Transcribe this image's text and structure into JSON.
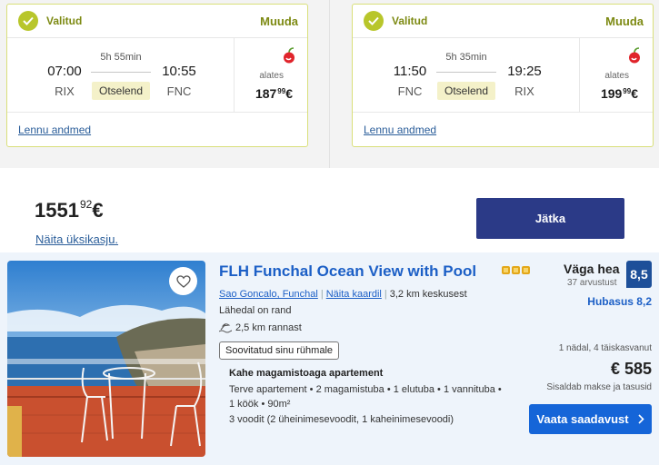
{
  "outbound": {
    "selected_label": "Valitud",
    "change_label": "Muuda",
    "dep_time": "07:00",
    "dep_code": "RIX",
    "duration": "5h 55min",
    "stops": "Otselend",
    "arr_time": "10:55",
    "arr_code": "FNC",
    "from_label": "alates",
    "price_main": "187",
    "price_cents": "99",
    "currency": "€",
    "details_label": "Lennu andmed",
    "airline_icon": "cherry-logo-icon"
  },
  "return": {
    "selected_label": "Valitud",
    "change_label": "Muuda",
    "dep_time": "11:50",
    "dep_code": "FNC",
    "duration": "5h 35min",
    "stops": "Otselend",
    "arr_time": "19:25",
    "arr_code": "RIX",
    "from_label": "alates",
    "price_main": "199",
    "price_cents": "99",
    "currency": "€",
    "details_label": "Lennu andmed",
    "airline_icon": "cherry-logo-icon"
  },
  "summary": {
    "total_main": "1551",
    "total_cents": "92",
    "currency": "€",
    "breakdown_label": "Näita üksikasju.",
    "continue_label": "Jätka"
  },
  "hotel": {
    "name": "FLH Funchal Ocean View with Pool",
    "star_count": 3,
    "location": "Sao Goncalo, Funchal",
    "map_link": "Näita kaardil",
    "distance": "3,2 km keskusest",
    "beach": "Lähedal on rand",
    "sea_distance": "2,5 km rannast",
    "tag": "Soovitatud sinu rühmale",
    "apartment_title": "Kahe magamistoaga apartement",
    "apartment_details_1": "Terve apartement • 2 magamistuba • 1 elutuba • 1 vannituba •",
    "apartment_details_2": "1 köök • 90m²",
    "beds": "3 voodit (2 üheinimesevoodit, 1 kaheinimesevoodi)",
    "rating_word": "Väga hea",
    "review_count": "37 arvustust",
    "score": "8,5",
    "price_rating": "Hubasus 8,2",
    "stay": "1 nädal, 4 täiskasvanut",
    "price": "€ 585",
    "taxes": "Sisaldab makse ja tasusid",
    "cta": "Vaata saadavust",
    "colors": {
      "primary_blue": "#1565d8",
      "score_bg": "#1d4f99",
      "selected_green": "#b8c62b"
    }
  }
}
